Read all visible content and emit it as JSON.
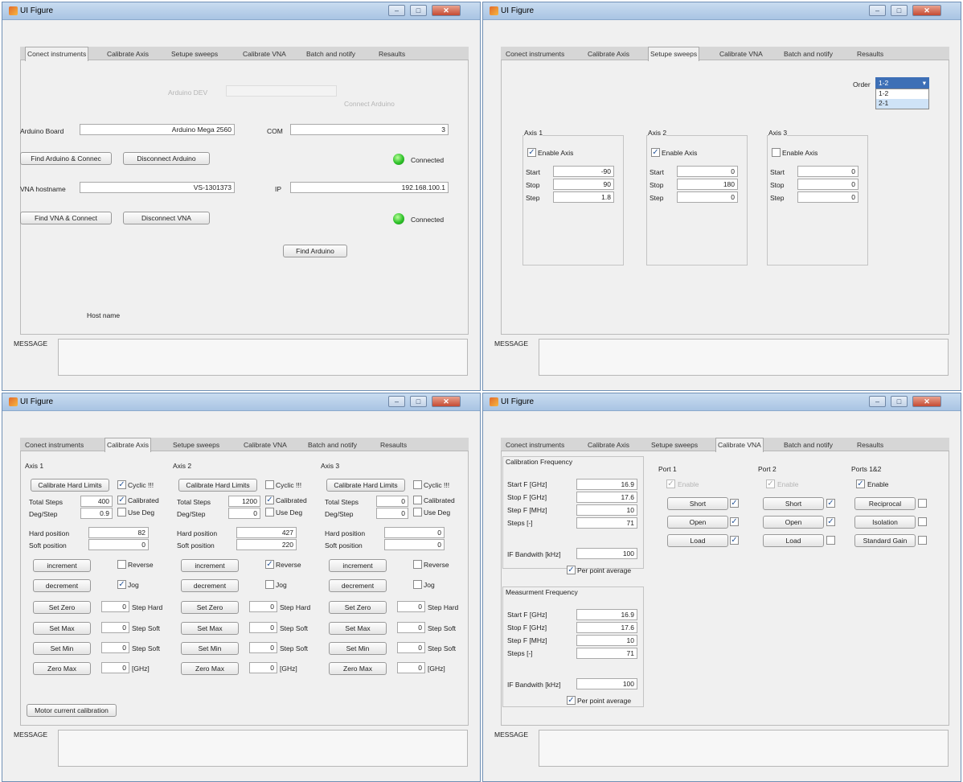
{
  "title": "UI Figure",
  "tabs": [
    "Conect instruments",
    "Calibrate Axis",
    "Setupe sweeps",
    "Calibrate VNA",
    "Batch and notify",
    "Resaults"
  ],
  "message_label": "MESSAGE",
  "win1": {
    "arduino_dev_label": "Arduino DEV",
    "connect_arduino_ghost": "Connect Arduino",
    "arduino_board_label": "Arduino Board",
    "arduino_board_value": "Arduino Mega 2560",
    "com_label": "COM",
    "com_value": "3",
    "find_arduino_connect": "Find Arduino & Connec",
    "disconnect_arduino": "Disconnect Arduino",
    "connected_1": "Connected",
    "vna_hostname_label": "VNA hostname",
    "vna_hostname_value": "VS-1301373",
    "ip_label": "IP",
    "ip_value": "192.168.100.1",
    "find_vna_connect": "Find VNA & Connect",
    "disconnect_vna": "Disconnect VNA",
    "connected_2": "Connected",
    "find_arduino": "Find Arduino",
    "host_name": "Host name"
  },
  "win2": {
    "order_label": "Order",
    "order_value": "1-2",
    "order_options": [
      "1-2",
      "2-1"
    ],
    "axes": [
      {
        "title": "Axis 1",
        "enable": "Enable Axis",
        "checked": true,
        "start_label": "Start",
        "stop_label": "Stop",
        "step_label": "Step",
        "start": "-90",
        "stop": "90",
        "step": "1.8"
      },
      {
        "title": "Axis 2",
        "enable": "Enable Axis",
        "checked": true,
        "start_label": "Start",
        "stop_label": "Stop",
        "step_label": "Step",
        "start": "0",
        "stop": "180",
        "step": "0"
      },
      {
        "title": "Axis 3",
        "enable": "Enable Axis",
        "checked": false,
        "start_label": "Start",
        "stop_label": "Stop",
        "step_label": "Step",
        "start": "0",
        "stop": "0",
        "step": "0"
      }
    ]
  },
  "win3": {
    "axes": [
      {
        "title": "Axis 1",
        "cal_hard": "Calibrate Hard Limits",
        "cyclic": "Cyclic !!!",
        "cyclic_checked": true,
        "total_steps_label": "Total Steps",
        "total_steps": "400",
        "calibrated": "Calibrated",
        "calibrated_checked": true,
        "deg_step_label": "Deg/Step",
        "deg_step": "0.9",
        "use_deg": "Use Deg",
        "hard_pos_label": "Hard position",
        "hard_pos": "82",
        "soft_pos_label": "Soft position",
        "soft_pos": "0",
        "increment": "increment",
        "reverse": "Reverse",
        "reverse_checked": false,
        "decrement": "decrement",
        "jog": "Jog",
        "jog_checked": true,
        "set_zero": "Set Zero",
        "set_max": "Set Max",
        "set_min": "Set Min",
        "zero_max": "Zero Max",
        "v1": "0",
        "v2": "0",
        "v3": "0",
        "v4": "0",
        "step_hard": "Step Hard",
        "step_soft1": "Step Soft",
        "step_soft2": "Step Soft",
        "ghz": "[GHz]"
      },
      {
        "title": "Axis 2",
        "cal_hard": "Calibrate Hard Limits",
        "cyclic": "Cyclic !!!",
        "cyclic_checked": false,
        "total_steps_label": "Total Steps",
        "total_steps": "1200",
        "calibrated": "Calibrated",
        "calibrated_checked": true,
        "deg_step_label": "Deg/Step",
        "deg_step": "0",
        "use_deg": "Use Deg",
        "hard_pos_label": "Hard position",
        "hard_pos": "427",
        "soft_pos_label": "Soft position",
        "soft_pos": "220",
        "increment": "increment",
        "reverse": "Reverse",
        "reverse_checked": true,
        "decrement": "decrement",
        "jog": "Jog",
        "jog_checked": false,
        "set_zero": "Set Zero",
        "set_max": "Set Max",
        "set_min": "Set Min",
        "zero_max": "Zero Max",
        "v1": "0",
        "v2": "0",
        "v3": "0",
        "v4": "0",
        "step_hard": "Step Hard",
        "step_soft1": "Step Soft",
        "step_soft2": "Step Soft",
        "ghz": "[GHz]"
      },
      {
        "title": "Axis 3",
        "cal_hard": "Calibrate Hard Limits",
        "cyclic": "Cyclic !!!",
        "cyclic_checked": false,
        "total_steps_label": "Total Steps",
        "total_steps": "0",
        "calibrated": "Calibrated",
        "calibrated_checked": false,
        "deg_step_label": "Deg/Step",
        "deg_step": "0",
        "use_deg": "Use Deg",
        "hard_pos_label": "Hard position",
        "hard_pos": "0",
        "soft_pos_label": "Soft position",
        "soft_pos": "0",
        "increment": "increment",
        "reverse": "Reverse",
        "reverse_checked": false,
        "decrement": "decrement",
        "jog": "Jog",
        "jog_checked": false,
        "set_zero": "Set Zero",
        "set_max": "Set Max",
        "set_min": "Set Min",
        "zero_max": "Zero Max",
        "v1": "0",
        "v2": "0",
        "v3": "0",
        "v4": "0",
        "step_hard": "Step Hard",
        "step_soft1": "Step Soft",
        "step_soft2": "Step Soft",
        "ghz": "[GHz]"
      }
    ],
    "motor_cal": "Motor current calibration"
  },
  "win4": {
    "cal_freq_title": "Calibration Frequency",
    "meas_freq_title": "Measurment Frequency",
    "cal": {
      "start_label": "Start F [GHz]",
      "stop_label": "Stop F [GHz]",
      "step_label": "Step F [MHz]",
      "steps_label": "Steps [-]",
      "start": "16.9",
      "stop": "17.6",
      "step": "10",
      "steps": "71",
      "ifbw_label": "IF Bandwith [kHz]",
      "ifbw": "100",
      "avg": "Per point average"
    },
    "meas": {
      "start_label": "Start F [GHz]",
      "stop_label": "Stop F [GHz]",
      "step_label": "Step F [MHz]",
      "steps_label": "Steps [-]",
      "start": "16.9",
      "stop": "17.6",
      "step": "10",
      "steps": "71",
      "ifbw_label": "IF Bandwith [kHz]",
      "ifbw": "100",
      "avg": "Per point average"
    },
    "port1": {
      "title": "Port 1",
      "enable": "Enable",
      "short": "Short",
      "open": "Open",
      "load": "Load"
    },
    "port2": {
      "title": "Port 2",
      "enable": "Enable",
      "short": "Short",
      "open": "Open",
      "load": "Load"
    },
    "ports12": {
      "title": "Ports 1&2",
      "enable": "Enable",
      "reciprocal": "Reciprocal",
      "isolation": "Isolation",
      "std_gain": "Standard Gain"
    }
  }
}
